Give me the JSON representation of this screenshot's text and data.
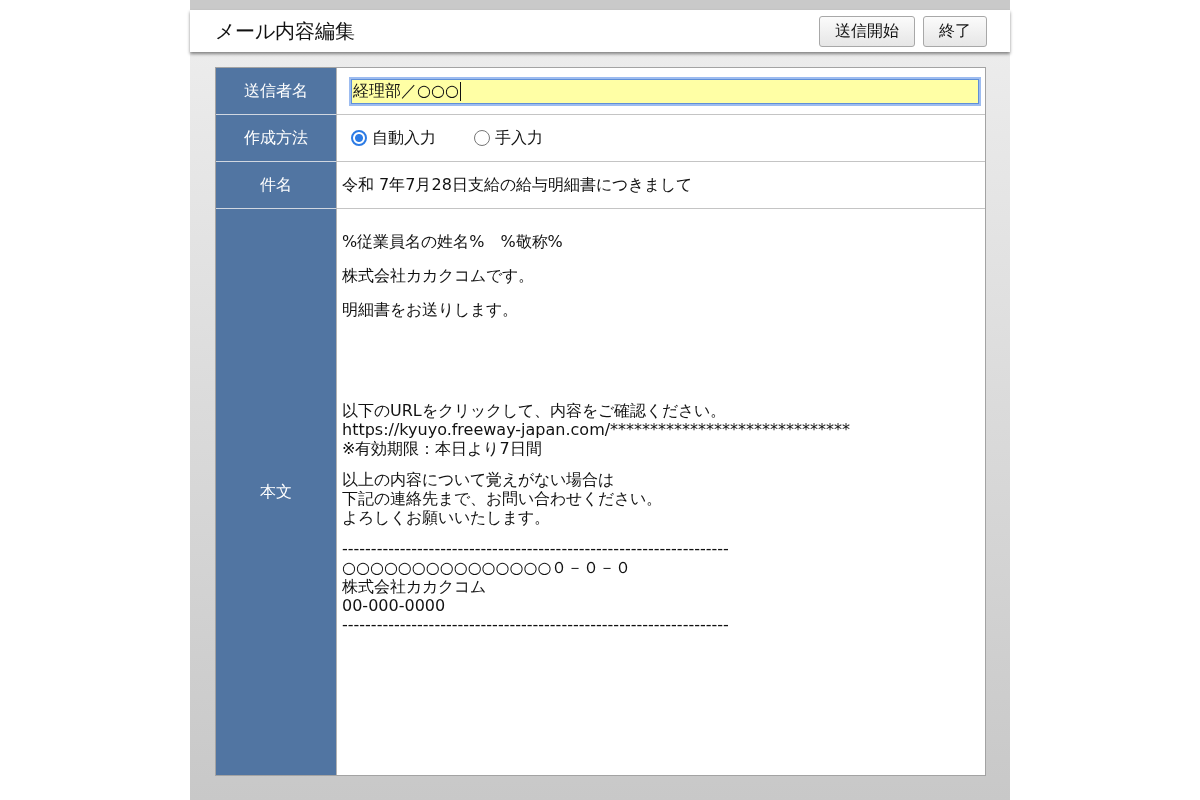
{
  "header": {
    "title": "メール内容編集",
    "buttons": [
      {
        "label": "送信開始"
      },
      {
        "label": "終了"
      }
    ]
  },
  "form": {
    "rows": [
      {
        "kind": "input",
        "label": "送信者名",
        "value": "経理部／○○○",
        "focused": true
      },
      {
        "kind": "radio",
        "label": "作成方法",
        "options": [
          {
            "label": "自動入力",
            "selected": true
          },
          {
            "label": "手入力",
            "selected": false
          }
        ]
      },
      {
        "kind": "text",
        "label": "件名",
        "value": "令和 7年7月28日支給の給与明細書につきまして"
      },
      {
        "kind": "body",
        "label": "本文",
        "paragraphs": [
          "%従業員名の姓名%　%敬称%",
          "株式会社カカクコムです。",
          "明細書をお送りします。"
        ],
        "blocks": [
          {
            "lines": [
              "以下のURLをクリックして、内容をご確認ください。",
              "https://kyuyo.freeway-japan.com/******************************",
              "※有効期限：本日より7日間"
            ]
          },
          {
            "lines": [
              "以上の内容について覚えがない場合は",
              "下記の連絡先まで、お問い合わせください。",
              "よろしくお願いいたします。"
            ]
          },
          {
            "lines": [
              "-------------------------------------------------------------------",
              "○○○○○○○○○○○○○○○０－０－０",
              "株式会社カカクコム",
              "00-000-0000",
              "-------------------------------------------------------------------"
            ]
          }
        ]
      }
    ]
  }
}
